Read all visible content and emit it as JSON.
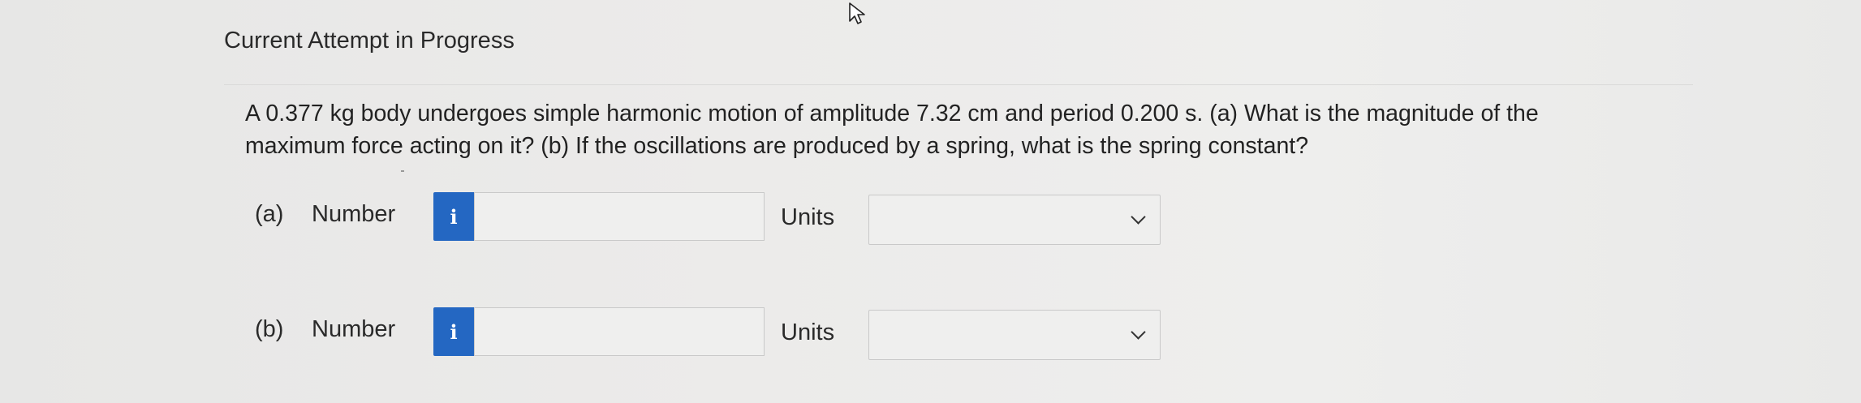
{
  "page": {
    "heading": "Current Attempt in Progress",
    "question": "A 0.377 kg body undergoes simple harmonic motion of amplitude 7.32 cm and period 0.200 s. (a) What is the magnitude of the maximum force acting on it? (b) If the oscillations are produced by a spring, what is the spring constant?"
  },
  "answers": [
    {
      "part_label": "(a)",
      "number_label": "Number",
      "info_icon": "i",
      "number_value": "",
      "units_label": "Units",
      "units_selected": ""
    },
    {
      "part_label": "(b)",
      "number_label": "Number",
      "info_icon": "i",
      "number_value": "",
      "units_label": "Units",
      "units_selected": ""
    }
  ],
  "colors": {
    "info_button": "#2467c2",
    "background": "#ecebea"
  }
}
